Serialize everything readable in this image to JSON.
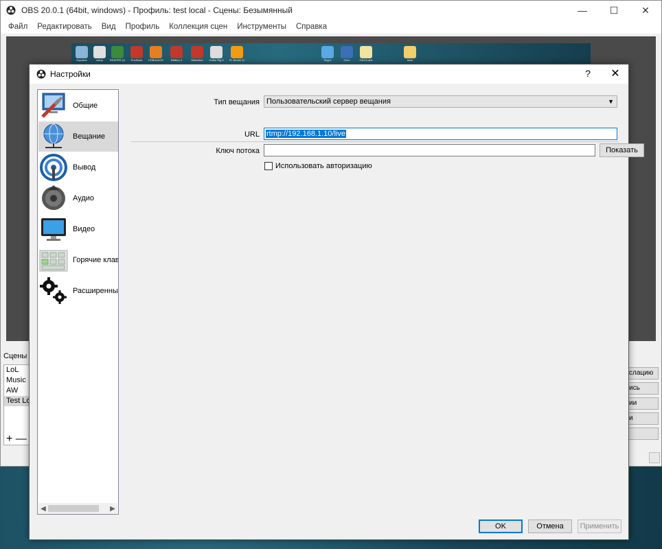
{
  "obs": {
    "title": "OBS 20.0.1 (64bit, windows) - Профиль: test local - Сцены: Безымянный",
    "menu": [
      "Файл",
      "Редактировать",
      "Вид",
      "Профиль",
      "Коллекция сцен",
      "Инструменты",
      "Справка"
    ],
    "win_controls": {
      "minimize": "—",
      "maximize": "☐",
      "close": "✕"
    },
    "scenes_header": "Сцены",
    "scenes": [
      "LoL",
      "Music",
      "AW",
      "Test Lo"
    ],
    "selected_scene": "Test Lo",
    "scene_tools": {
      "add": "+",
      "remove": "—"
    },
    "right_buttons": [
      "слацию",
      "ись",
      "ии",
      "и",
      ""
    ]
  },
  "desktop_icons": [
    {
      "label": "Корзина",
      "color": "#8ab4d8"
    },
    {
      "label": "setup",
      "color": "#e0e0e0"
    },
    {
      "label": "REAPER (x64)",
      "color": "#3c8a3c"
    },
    {
      "label": "Poolfrack",
      "color": "#c0392b"
    },
    {
      "label": "CDBurnerXP",
      "color": "#e67e22"
    },
    {
      "label": "Battery 4",
      "color": "#c0392b"
    },
    {
      "label": "Maschine",
      "color": "#c0392b"
    },
    {
      "label": "Guitar Rig 5",
      "color": "#dddddd"
    },
    {
      "label": "FL Studio 12",
      "color": "#f39c12"
    },
    {
      "label": "Skype",
      "color": "#5aa9e6"
    },
    {
      "label": "Сеть",
      "color": "#3b6fb6"
    },
    {
      "label": "GfxCtr.ahk",
      "color": "#f1e3a0"
    },
    {
      "label": "Мои",
      "color": "#f1d06a"
    }
  ],
  "dialog": {
    "title": "Настройки",
    "help": "?",
    "close": "✕",
    "sidebar": [
      {
        "label": "Общие",
        "icon": "general-icon"
      },
      {
        "label": "Вещание",
        "icon": "broadcast-globe-icon"
      },
      {
        "label": "Вывод",
        "icon": "output-signal-icon"
      },
      {
        "label": "Аудио",
        "icon": "speaker-icon"
      },
      {
        "label": "Видео",
        "icon": "monitor-icon"
      },
      {
        "label": "Горячие клав",
        "icon": "hotkeys-icon"
      },
      {
        "label": "Расширенны",
        "icon": "gears-icon"
      }
    ],
    "active_item": "Вещание",
    "form": {
      "service_type_label": "Тип вещания",
      "service_type_value": "Пользовательский сервер вещания",
      "url_label": "URL",
      "url_value": "rtmp://192.168.1.10/live",
      "stream_key_label": "Ключ потока",
      "stream_key_value": "",
      "show_button": "Показать",
      "use_auth_label": "Использовать авторизацию",
      "use_auth_checked": false
    },
    "buttons": {
      "ok": "OK",
      "cancel": "Отмена",
      "apply": "Применить"
    }
  }
}
